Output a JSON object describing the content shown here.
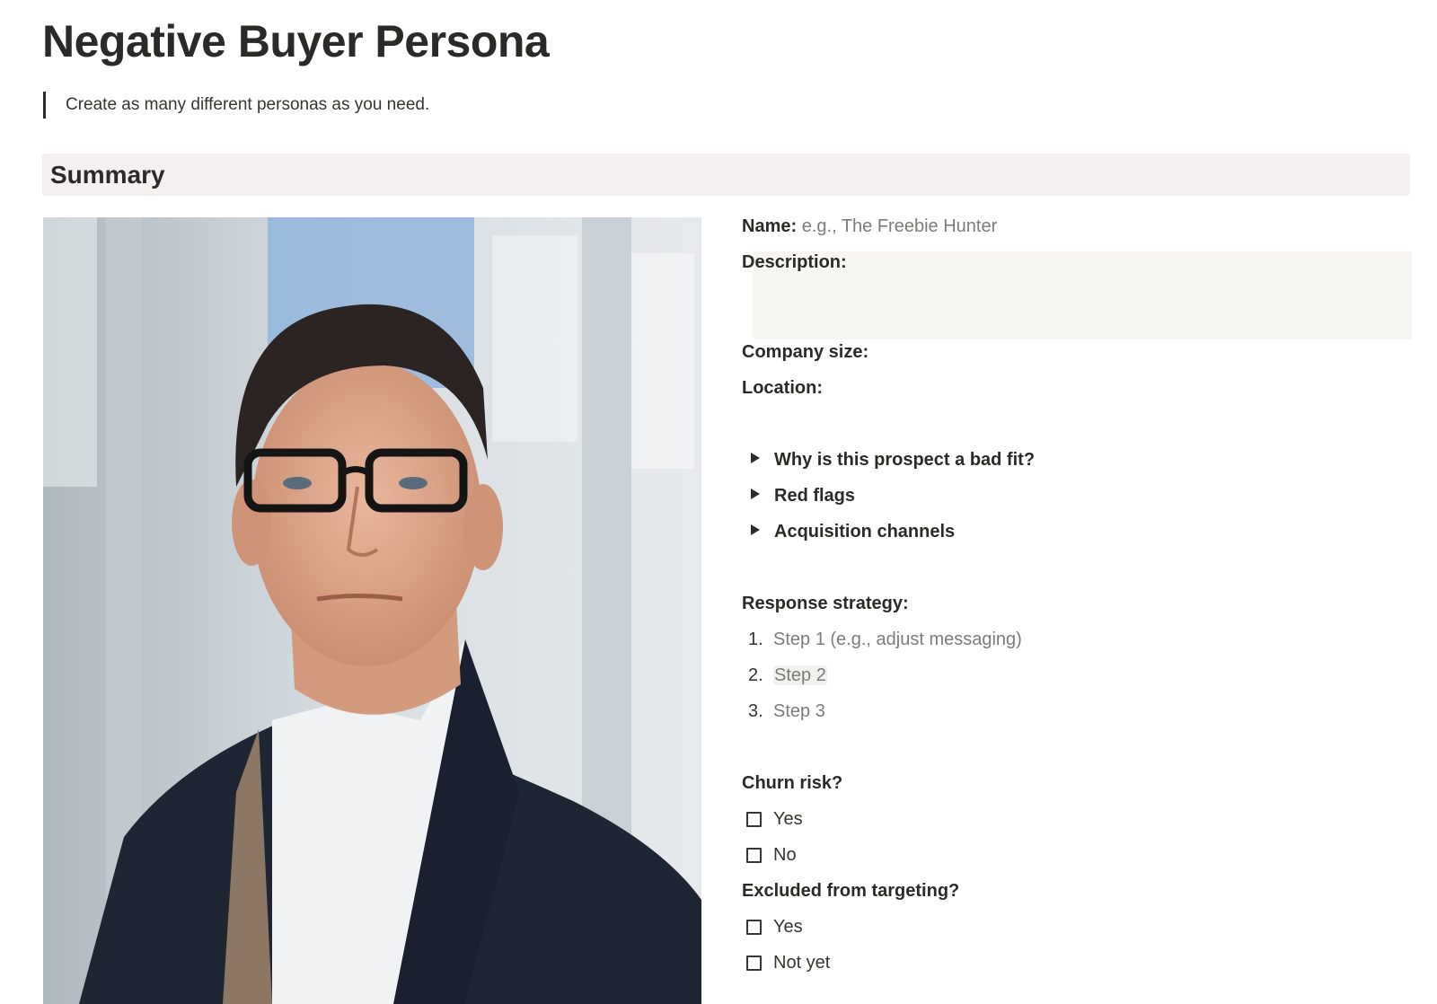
{
  "page": {
    "title": "Negative Buyer Persona",
    "quote": "Create as many different personas as you need."
  },
  "summary": {
    "heading": "Summary"
  },
  "profile": {
    "name_label": "Name:",
    "name_placeholder": "e.g., The Freebie Hunter",
    "description_label": "Description:",
    "company_size_label": "Company size:",
    "location_label": "Location:"
  },
  "toggles": [
    {
      "label": "Why is this prospect a bad fit?"
    },
    {
      "label": "Red flags"
    },
    {
      "label": "Acquisition channels"
    }
  ],
  "response": {
    "label": "Response strategy:",
    "steps": [
      {
        "num": "1.",
        "text": "Step 1 (e.g., adjust messaging)"
      },
      {
        "num": "2.",
        "text": "Step 2"
      },
      {
        "num": "3.",
        "text": "Step 3"
      }
    ]
  },
  "churn": {
    "label": "Churn risk?",
    "options": [
      {
        "label": "Yes",
        "checked": false
      },
      {
        "label": "No",
        "checked": false
      }
    ]
  },
  "excluded": {
    "label": "Excluded from targeting?",
    "options": [
      {
        "label": "Yes",
        "checked": false
      },
      {
        "label": "Not yet",
        "checked": false
      }
    ]
  },
  "icons": {
    "toggle": "triangle-right-icon",
    "checkbox": "checkbox-empty-icon",
    "photo": "persona-portrait-photo"
  },
  "colors": {
    "text": "#37352f",
    "placeholder": "#7d7b76",
    "summary_bg": "#f4f0ef",
    "description_bg": "#f7f6f3"
  }
}
